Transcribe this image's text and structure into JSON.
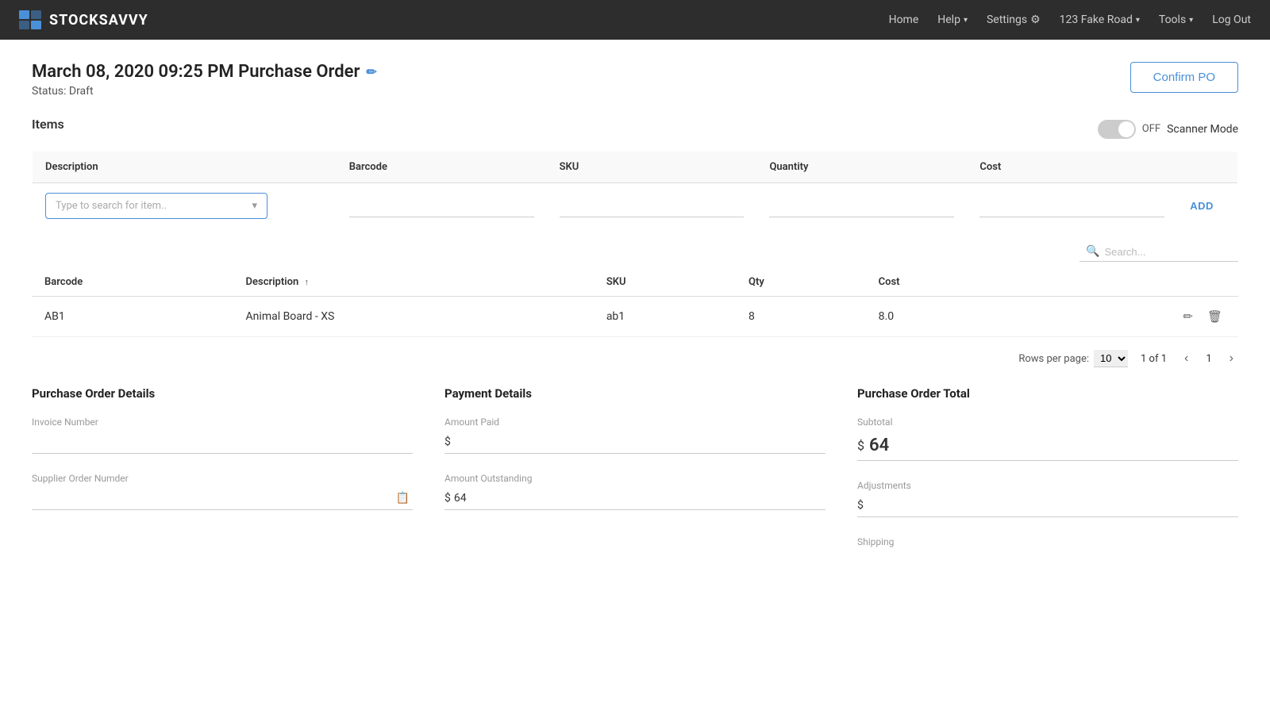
{
  "nav": {
    "brand": "STOCKSAVVY",
    "links": [
      {
        "label": "Home",
        "dropdown": false
      },
      {
        "label": "Help",
        "dropdown": true
      },
      {
        "label": "Settings",
        "dropdown": false,
        "icon": "gear"
      },
      {
        "label": "123 Fake Road",
        "dropdown": true
      },
      {
        "label": "Tools",
        "dropdown": true
      },
      {
        "label": "Log Out",
        "dropdown": false
      }
    ]
  },
  "page": {
    "title": "March 08, 2020 09:25 PM Purchase Order",
    "status": "Status: Draft",
    "confirm_btn": "Confirm PO"
  },
  "items_section": {
    "heading": "Items",
    "scanner_mode_label": "Scanner Mode",
    "toggle_state": "OFF",
    "add_row": {
      "description_placeholder": "Type to search for item..",
      "add_label": "ADD"
    },
    "table_headers": [
      "Description",
      "Barcode",
      "SKU",
      "Quantity",
      "Cost"
    ],
    "search_placeholder": "Search...",
    "data_headers": [
      "Barcode",
      "Description",
      "SKU",
      "Qty",
      "Cost"
    ],
    "rows": [
      {
        "barcode": "AB1",
        "description": "Animal Board - XS",
        "sku": "ab1",
        "qty": "8",
        "cost": "8.0"
      }
    ],
    "pagination": {
      "rows_per_page_label": "Rows per page:",
      "rows_per_page_value": "10",
      "page_info": "1 of 1",
      "current_page": "1"
    }
  },
  "bottom": {
    "purchase_order_details": {
      "heading": "Purchase Order Details",
      "invoice_number_label": "Invoice Number",
      "invoice_number_value": "",
      "supplier_order_label": "Supplier Order Numder",
      "supplier_order_value": ""
    },
    "payment_details": {
      "heading": "Payment Details",
      "amount_paid_label": "Amount Paid",
      "amount_paid_value": "",
      "amount_outstanding_label": "Amount Outstanding",
      "amount_outstanding_value": "64"
    },
    "purchase_order_total": {
      "heading": "Purchase Order Total",
      "subtotal_label": "Subtotal",
      "subtotal_value": "64",
      "adjustments_label": "Adjustments",
      "adjustments_value": "",
      "shipping_label": "Shipping"
    }
  }
}
